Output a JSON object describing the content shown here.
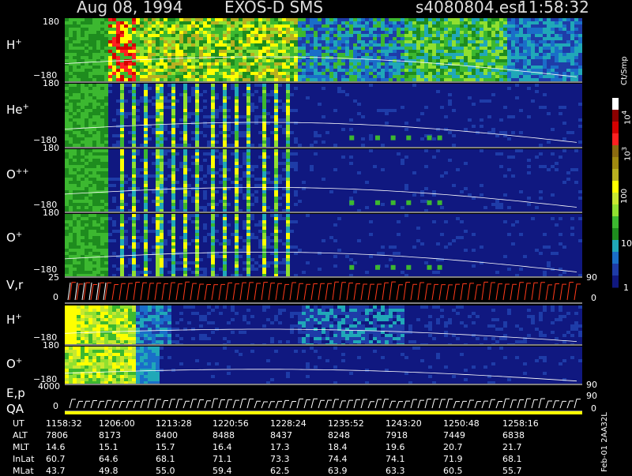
{
  "header": {
    "date": "Aug 08, 1994",
    "mission": "EXOS-D SMS",
    "file": "s4080804.esr",
    "time": "11:58:32"
  },
  "colorbar": {
    "unit": "Ct/Smp",
    "ticks": [
      "10",
      "10",
      "100",
      "10",
      "1"
    ],
    "exponents": [
      "4",
      "3"
    ],
    "colors": [
      "#ffffff",
      "#8b0000",
      "#d40000",
      "#ff2020",
      "#8a6a10",
      "#a08a10",
      "#b8b020",
      "#ffff00",
      "#c8e830",
      "#90e030",
      "#3cb830",
      "#1e8c1e",
      "#20a8b8",
      "#1a6ec8",
      "#1e3ca8",
      "#101880"
    ]
  },
  "panels": [
    {
      "species": "H",
      "charge": "+",
      "ymax": "180",
      "ymin": "−180"
    },
    {
      "species": "He",
      "charge": "+",
      "ymax": "180",
      "ymin": "−180"
    },
    {
      "species": "O",
      "charge": "++",
      "ymax": "180",
      "ymin": "−180"
    },
    {
      "species": "O",
      "charge": "+",
      "ymax": "180",
      "ymin": "−180"
    },
    {
      "species": "V,r",
      "charge": "",
      "ymax": "25",
      "ymin": "0",
      "right_top": "90",
      "right_bot": "0"
    },
    {
      "species": "H",
      "charge": "+",
      "ymax": "180",
      "ymin": "−180"
    },
    {
      "species": "O",
      "charge": "+",
      "ymax": "180",
      "ymin": "−180",
      "right_bot": "90"
    },
    {
      "species": "E,p",
      "charge": "",
      "ymax": "4000",
      "ymin": "0",
      "right_top": "90",
      "right_bot": "0"
    },
    {
      "species": "QA",
      "charge": "",
      "ymax": "",
      "ymin": ""
    }
  ],
  "table": {
    "rows": [
      {
        "label": "UT",
        "values": [
          "1158:32",
          "1206:00",
          "1213:28",
          "1220:56",
          "1228:24",
          "1235:52",
          "1243:20",
          "1250:48",
          "1258:16"
        ]
      },
      {
        "label": "ALT",
        "values": [
          "7806",
          "8173",
          "8400",
          "8488",
          "8437",
          "8248",
          "7918",
          "7449",
          "6838"
        ]
      },
      {
        "label": "MLT",
        "values": [
          "14.6",
          "15.1",
          "15.7",
          "16.4",
          "17.3",
          "18.4",
          "19.6",
          "20.7",
          "21.7"
        ]
      },
      {
        "label": "InLat",
        "values": [
          "60.7",
          "64.6",
          "68.1",
          "71.1",
          "73.3",
          "74.4",
          "74.1",
          "71.9",
          "68.1"
        ]
      },
      {
        "label": "MLat",
        "values": [
          "43.7",
          "49.8",
          "55.0",
          "59.4",
          "62.5",
          "63.9",
          "63.3",
          "60.5",
          "55.7"
        ]
      }
    ]
  },
  "footer": {
    "stamp": "Feb-01 2AA32L"
  },
  "chart_data": {
    "type": "heatmap",
    "title": "Aug 08, 1994   EXOS-D SMS",
    "xlabel": "UT",
    "x_ticks": [
      "1158:32",
      "1206:00",
      "1213:28",
      "1220:56",
      "1228:24",
      "1235:52",
      "1243:20",
      "1250:48",
      "1258:16"
    ],
    "ylim": [
      -180,
      180
    ],
    "color_scale": "log",
    "color_range": [
      1,
      10000
    ],
    "color_unit": "Ct/Smp",
    "series": [
      {
        "name": "H+"
      },
      {
        "name": "He+"
      },
      {
        "name": "O++"
      },
      {
        "name": "O+"
      },
      {
        "name": "V,r"
      },
      {
        "name": "H+"
      },
      {
        "name": "O+"
      },
      {
        "name": "E,p"
      },
      {
        "name": "QA"
      }
    ]
  }
}
